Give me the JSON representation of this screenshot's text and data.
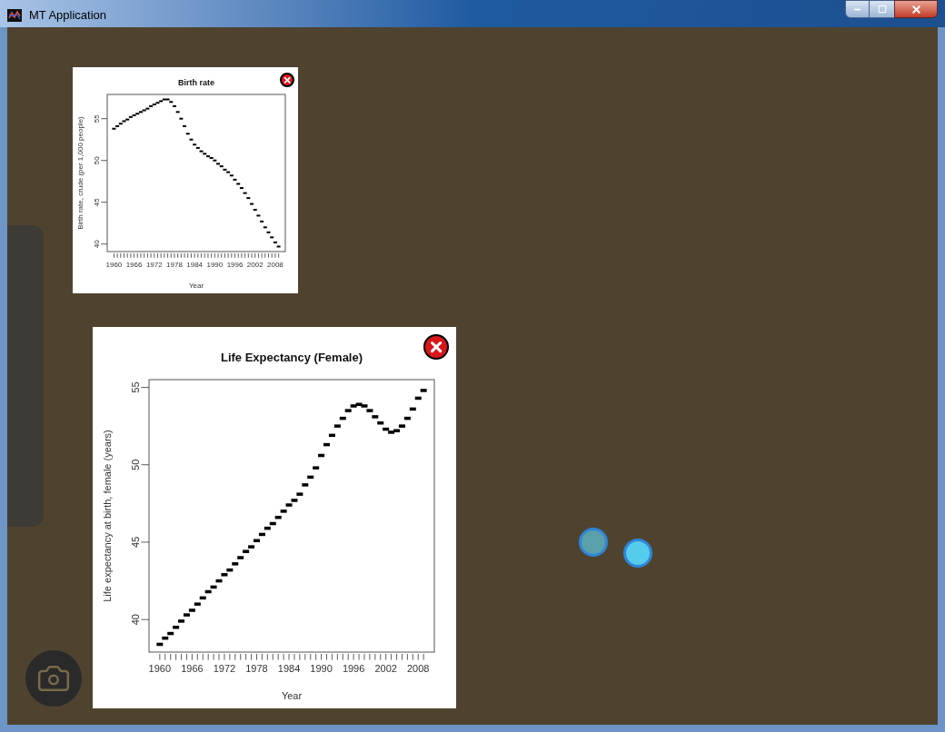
{
  "window": {
    "title": "MT Application"
  },
  "map": {
    "markers": [
      {
        "kind": "faded"
      },
      {
        "kind": "solid"
      }
    ]
  },
  "chart_windows": [
    {
      "chart_data": {
        "type": "scatter",
        "title": "Birth rate",
        "xlabel": "Year",
        "ylabel": "Birth rate, crude (per 1,000 people)",
        "x": [
          1960,
          1961,
          1962,
          1963,
          1964,
          1965,
          1966,
          1967,
          1968,
          1969,
          1970,
          1971,
          1972,
          1973,
          1974,
          1975,
          1976,
          1977,
          1978,
          1979,
          1980,
          1981,
          1982,
          1983,
          1984,
          1985,
          1986,
          1987,
          1988,
          1989,
          1990,
          1991,
          1992,
          1993,
          1994,
          1995,
          1996,
          1997,
          1998,
          1999,
          2000,
          2001,
          2002,
          2003,
          2004,
          2005,
          2006,
          2007,
          2008,
          2009
        ],
        "values": [
          53.8,
          54.1,
          54.4,
          54.7,
          54.9,
          55.2,
          55.4,
          55.6,
          55.8,
          56.0,
          56.2,
          56.5,
          56.7,
          56.9,
          57.1,
          57.3,
          57.3,
          57.0,
          56.5,
          55.8,
          55.0,
          54.1,
          53.2,
          52.5,
          51.9,
          51.5,
          51.1,
          50.8,
          50.5,
          50.3,
          50.0,
          49.6,
          49.3,
          48.9,
          48.6,
          48.2,
          47.7,
          47.2,
          46.7,
          46.1,
          45.5,
          44.8,
          44.1,
          43.4,
          42.7,
          42.0,
          41.4,
          40.8,
          40.2,
          39.7
        ],
        "xlim": [
          1958,
          2011
        ],
        "ylim": [
          39.1,
          57.9
        ],
        "xticks": [
          1960,
          1966,
          1972,
          1978,
          1984,
          1990,
          1996,
          2002,
          2008
        ],
        "yticks": [
          40,
          45,
          50,
          55
        ]
      }
    },
    {
      "chart_data": {
        "type": "scatter",
        "title": "Life Expectancy (Female)",
        "xlabel": "Year",
        "ylabel": "Life expectancy at birth, female (years)",
        "x": [
          1960,
          1961,
          1962,
          1963,
          1964,
          1965,
          1966,
          1967,
          1968,
          1969,
          1970,
          1971,
          1972,
          1973,
          1974,
          1975,
          1976,
          1977,
          1978,
          1979,
          1980,
          1981,
          1982,
          1983,
          1984,
          1985,
          1986,
          1987,
          1988,
          1989,
          1990,
          1991,
          1992,
          1993,
          1994,
          1995,
          1996,
          1997,
          1998,
          1999,
          2000,
          2001,
          2002,
          2003,
          2004,
          2005,
          2006,
          2007,
          2008,
          2009
        ],
        "values": [
          38.4,
          38.8,
          39.1,
          39.5,
          39.9,
          40.3,
          40.6,
          41.0,
          41.4,
          41.8,
          42.1,
          42.5,
          42.9,
          43.2,
          43.6,
          44.0,
          44.4,
          44.7,
          45.1,
          45.5,
          45.9,
          46.2,
          46.6,
          47.0,
          47.4,
          47.7,
          48.1,
          48.7,
          49.2,
          49.8,
          50.6,
          51.3,
          51.9,
          52.5,
          53.0,
          53.5,
          53.8,
          53.9,
          53.8,
          53.5,
          53.1,
          52.7,
          52.3,
          52.1,
          52.2,
          52.5,
          53.0,
          53.6,
          54.3,
          54.8
        ],
        "xlim": [
          1958,
          2011
        ],
        "ylim": [
          37.9,
          55.5
        ],
        "xticks": [
          1960,
          1966,
          1972,
          1978,
          1984,
          1990,
          1996,
          2002,
          2008
        ],
        "yticks": [
          40,
          45,
          50,
          55
        ]
      }
    }
  ]
}
